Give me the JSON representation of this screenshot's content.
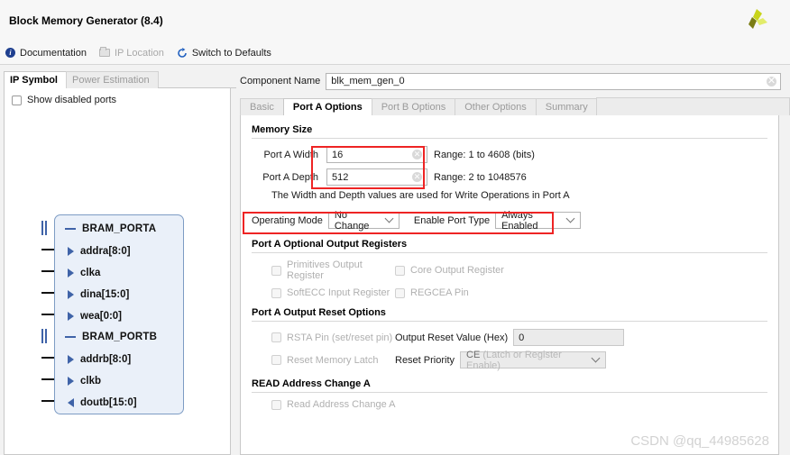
{
  "window": {
    "title": "Block Memory Generator (8.4)",
    "logo_icon": "xilinx-pinwheel-logo"
  },
  "toolbar": {
    "items": [
      {
        "label": "Documentation",
        "icon": "info-icon",
        "disabled": false
      },
      {
        "label": "IP Location",
        "icon": "folder-icon",
        "disabled": true
      },
      {
        "label": "Switch to Defaults",
        "icon": "refresh-icon",
        "disabled": false
      }
    ]
  },
  "left_panel": {
    "tabs": [
      {
        "label": "IP Symbol",
        "active": true
      },
      {
        "label": "Power Estimation",
        "active": false
      }
    ],
    "show_disabled_ports": {
      "label": "Show disabled ports",
      "checked": false
    },
    "symbol": {
      "groups": [
        {
          "name": "BRAM_PORTA",
          "ports": [
            {
              "label": "addra[8:0]",
              "direction": "in"
            },
            {
              "label": "clka",
              "direction": "in"
            },
            {
              "label": "dina[15:0]",
              "direction": "in"
            },
            {
              "label": "wea[0:0]",
              "direction": "in"
            }
          ]
        },
        {
          "name": "BRAM_PORTB",
          "ports": [
            {
              "label": "addrb[8:0]",
              "direction": "in"
            },
            {
              "label": "clkb",
              "direction": "in"
            },
            {
              "label": "doutb[15:0]",
              "direction": "out"
            }
          ]
        }
      ]
    }
  },
  "main": {
    "component_name": {
      "label": "Component Name",
      "value": "blk_mem_gen_0",
      "clear_icon": "clear-circle-icon"
    },
    "tabs": [
      {
        "label": "Basic",
        "active": false
      },
      {
        "label": "Port A Options",
        "active": true
      },
      {
        "label": "Port B Options",
        "active": false
      },
      {
        "label": "Other Options",
        "active": false
      },
      {
        "label": "Summary",
        "active": false
      }
    ],
    "memory_size": {
      "title": "Memory Size",
      "width": {
        "label": "Port A Width",
        "value": "16",
        "range": "Range: 1 to 4608 (bits)"
      },
      "depth": {
        "label": "Port A Depth",
        "value": "512",
        "range": "Range: 2 to 1048576"
      },
      "hint": "The Width and Depth values are used for Write Operations in Port A"
    },
    "mode_row": {
      "operating_mode": {
        "label": "Operating Mode",
        "value": "No Change"
      },
      "enable_port_type": {
        "label": "Enable Port Type",
        "value": "Always Enabled"
      }
    },
    "optional_output_registers": {
      "title": "Port A Optional Output Registers",
      "checkboxes": [
        {
          "label": "Primitives Output Register",
          "checked": false,
          "disabled": true
        },
        {
          "label": "Core Output Register",
          "checked": false,
          "disabled": true
        },
        {
          "label": "SoftECC Input Register",
          "checked": false,
          "disabled": true
        },
        {
          "label": "REGCEA Pin",
          "checked": false,
          "disabled": true
        }
      ]
    },
    "output_reset_options": {
      "title": "Port A Output Reset Options",
      "rsta_pin": {
        "label": "RSTA Pin (set/reset pin)",
        "checked": false,
        "disabled": true
      },
      "reset_memory_latch": {
        "label": "Reset Memory Latch",
        "checked": false,
        "disabled": true
      },
      "output_reset_value": {
        "label": "Output Reset Value (Hex)",
        "value": "0"
      },
      "reset_priority": {
        "label": "Reset Priority",
        "value_strong": "CE",
        "value_rest": "(Latch or Register Enable)"
      }
    },
    "read_address_change": {
      "title": "READ Address Change A",
      "checkbox": {
        "label": "Read Address Change A",
        "checked": false,
        "disabled": true
      }
    },
    "watermark": "CSDN @qq_44985628"
  },
  "colors": {
    "annotation_red": "#ee2424",
    "symbol_blue": "#3f63a8",
    "accent_blue": "#1f3f8f"
  }
}
